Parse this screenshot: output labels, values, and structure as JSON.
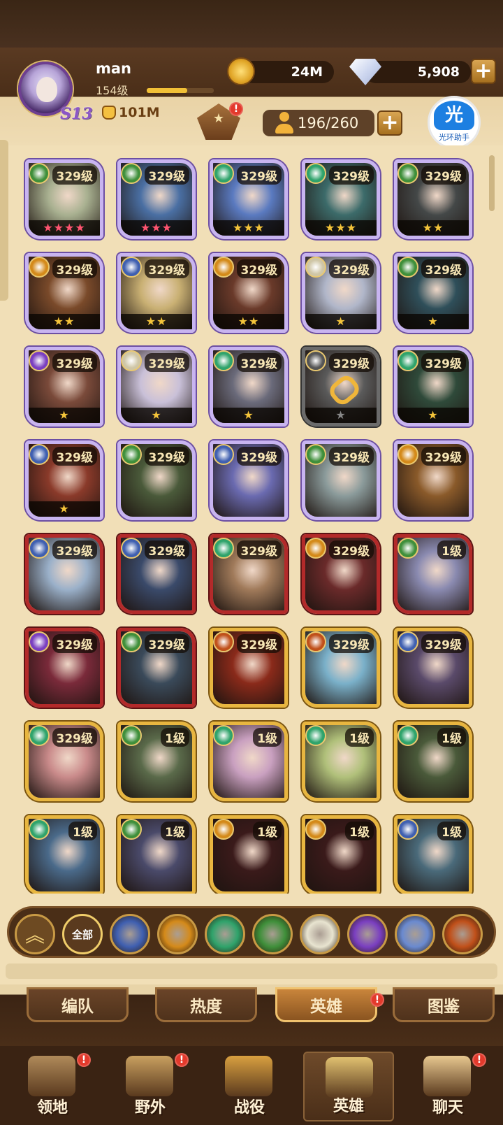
{
  "player": {
    "name": "man",
    "level": "154级",
    "season": "S13",
    "power": "101M",
    "xp_fraction": 0.6
  },
  "resources": {
    "gold": "24M",
    "diamonds": "5,908",
    "capacity": "196/260",
    "plus": "+"
  },
  "badges": {
    "alert": "!"
  },
  "helper": {
    "icon_text": "光",
    "label": "光环助手"
  },
  "heroes": [
    {
      "level": "329级",
      "frame": "purple",
      "stars": "★★★★",
      "star_color": "red",
      "faction": "#3f8f3a",
      "bg": "#a8b090"
    },
    {
      "level": "329级",
      "frame": "purple",
      "stars": "★★★",
      "star_color": "red",
      "faction": "#3f8f3a",
      "bg": "#4a6fa3"
    },
    {
      "level": "329级",
      "frame": "purple",
      "stars": "★★★",
      "star_color": "gold",
      "faction": "#2fa36b",
      "bg": "#5a7ac0"
    },
    {
      "level": "329级",
      "frame": "purple",
      "stars": "★★★",
      "star_color": "gold",
      "faction": "#2fa36b",
      "bg": "#3c6b6a"
    },
    {
      "level": "329级",
      "frame": "purple",
      "stars": "★★",
      "star_color": "gold",
      "faction": "#3f8f3a",
      "bg": "#444848"
    },
    {
      "level": "329级",
      "frame": "purple",
      "stars": "★★",
      "star_color": "gold",
      "faction": "#d48a1a",
      "bg": "#7a4a2a"
    },
    {
      "level": "329级",
      "frame": "purple",
      "stars": "★★",
      "star_color": "gold",
      "faction": "#3f5fb0",
      "bg": "#c9b073"
    },
    {
      "level": "329级",
      "frame": "purple",
      "stars": "★★",
      "star_color": "gold",
      "faction": "#d48a1a",
      "bg": "#6a3a2a"
    },
    {
      "level": "329级",
      "frame": "purple",
      "stars": "★",
      "star_color": "gold",
      "faction": "#cfc6a6",
      "bg": "#b0b6c9"
    },
    {
      "level": "329级",
      "frame": "purple",
      "stars": "★",
      "star_color": "gold",
      "faction": "#3f8f3a",
      "bg": "#2f4f5a"
    },
    {
      "level": "329级",
      "frame": "purple",
      "stars": "★",
      "star_color": "gold",
      "faction": "#7a3fc0",
      "bg": "#7a4a3a"
    },
    {
      "level": "329级",
      "frame": "purple",
      "stars": "★",
      "star_color": "gold",
      "faction": "#cfc6a6",
      "bg": "#c9c0d8"
    },
    {
      "level": "329级",
      "frame": "purple",
      "stars": "★",
      "star_color": "gold",
      "faction": "#2fa36b",
      "bg": "#6a6a7a"
    },
    {
      "level": "329级",
      "frame": "gray",
      "stars": "★",
      "star_color": "gray",
      "faction": "#555555",
      "bg": "#5a5a5a",
      "linked": true
    },
    {
      "level": "329级",
      "frame": "purple",
      "stars": "★",
      "star_color": "gold",
      "faction": "#2fa36b",
      "bg": "#2f4a3a"
    },
    {
      "level": "329级",
      "frame": "purple",
      "stars": "★",
      "star_color": "gold",
      "faction": "#3f5fb0",
      "bg": "#8a3a2a"
    },
    {
      "level": "329级",
      "frame": "purple",
      "stars": "",
      "star_color": "gold",
      "faction": "#3f8f3a",
      "bg": "#4a5a3a"
    },
    {
      "level": "329级",
      "frame": "purple",
      "stars": "",
      "star_color": "gold",
      "faction": "#3f5fb0",
      "bg": "#6a6ab0"
    },
    {
      "level": "329级",
      "frame": "purple",
      "stars": "",
      "star_color": "gold",
      "faction": "#3f8f3a",
      "bg": "#8a9a9a"
    },
    {
      "level": "329级",
      "frame": "purple",
      "stars": "",
      "star_color": "gold",
      "faction": "#d48a1a",
      "bg": "#8a5a2a"
    },
    {
      "level": "329级",
      "frame": "red",
      "stars": "",
      "star_color": "gold",
      "faction": "#3f5fb0",
      "bg": "#9ab0c9"
    },
    {
      "level": "329级",
      "frame": "red",
      "stars": "",
      "star_color": "gold",
      "faction": "#3f5fb0",
      "bg": "#3a4a6a"
    },
    {
      "level": "329级",
      "frame": "red",
      "stars": "",
      "star_color": "gold",
      "faction": "#2fa36b",
      "bg": "#a07a5a"
    },
    {
      "level": "329级",
      "frame": "red",
      "stars": "",
      "star_color": "gold",
      "faction": "#d48a1a",
      "bg": "#6a2a2a"
    },
    {
      "level": "1级",
      "frame": "red",
      "stars": "",
      "star_color": "gold",
      "faction": "#3f8f3a",
      "bg": "#8a8ab0"
    },
    {
      "level": "329级",
      "frame": "red",
      "stars": "",
      "star_color": "gold",
      "faction": "#7a3fc0",
      "bg": "#7a2a3a"
    },
    {
      "level": "329级",
      "frame": "red",
      "stars": "",
      "star_color": "gold",
      "faction": "#3f8f3a",
      "bg": "#3a4a5a"
    },
    {
      "level": "329级",
      "frame": "gold",
      "stars": "",
      "star_color": "gold",
      "faction": "#c0501a",
      "bg": "#8a2a1a"
    },
    {
      "level": "329级",
      "frame": "gold",
      "stars": "",
      "star_color": "gold",
      "faction": "#c0501a",
      "bg": "#7ab0c9"
    },
    {
      "level": "329级",
      "frame": "gold",
      "stars": "",
      "star_color": "gold",
      "faction": "#3f5fb0",
      "bg": "#5a4a6a"
    },
    {
      "level": "329级",
      "frame": "gold",
      "stars": "",
      "star_color": "gold",
      "faction": "#2fa36b",
      "bg": "#c98a8a"
    },
    {
      "level": "1级",
      "frame": "gold",
      "stars": "",
      "star_color": "gold",
      "faction": "#3f8f3a",
      "bg": "#5a6a4a"
    },
    {
      "level": "1级",
      "frame": "gold",
      "stars": "",
      "star_color": "gold",
      "faction": "#2fa36b",
      "bg": "#c9a0c0"
    },
    {
      "level": "1级",
      "frame": "gold",
      "stars": "",
      "star_color": "gold",
      "faction": "#2fa36b",
      "bg": "#b0c07a"
    },
    {
      "level": "1级",
      "frame": "gold",
      "stars": "",
      "star_color": "gold",
      "faction": "#2fa36b",
      "bg": "#4a5a3a"
    },
    {
      "level": "1级",
      "frame": "gold",
      "stars": "",
      "star_color": "gold",
      "faction": "#2fa36b",
      "bg": "#4a6a8a"
    },
    {
      "level": "1级",
      "frame": "gold",
      "stars": "",
      "star_color": "gold",
      "faction": "#3f8f3a",
      "bg": "#4a4a6a"
    },
    {
      "level": "1级",
      "frame": "gold",
      "stars": "",
      "star_color": "gold",
      "faction": "#d48a1a",
      "bg": "#3a1a1a"
    },
    {
      "level": "1级",
      "frame": "gold",
      "stars": "",
      "star_color": "gold",
      "faction": "#d48a1a",
      "bg": "#3a1a1a"
    },
    {
      "level": "1级",
      "frame": "gold",
      "stars": "",
      "star_color": "gold",
      "faction": "#3f5fb0",
      "bg": "#4a6a7a"
    }
  ],
  "filters": {
    "all_label": "全部",
    "factions": [
      {
        "name": "lightbearer-icon",
        "color": "#3f5fb0"
      },
      {
        "name": "mauler-icon",
        "color": "#d48a1a"
      },
      {
        "name": "wilder-icon",
        "color": "#2fa36b"
      },
      {
        "name": "graveborn-icon",
        "color": "#3f8f3a"
      },
      {
        "name": "celestial-icon",
        "color": "#e8e4d0"
      },
      {
        "name": "hypogean-icon",
        "color": "#7a3fc0"
      },
      {
        "name": "dimensional-icon",
        "color": "#6a8ad0"
      },
      {
        "name": "draconis-icon",
        "color": "#c0501a"
      }
    ]
  },
  "subtabs": [
    {
      "label": "编队",
      "active": false,
      "alert": false
    },
    {
      "label": "热度",
      "active": false,
      "alert": false
    },
    {
      "label": "英雄",
      "active": true,
      "alert": true
    },
    {
      "label": "图鉴",
      "active": false,
      "alert": false
    }
  ],
  "nav": [
    {
      "label": "领地",
      "icon": "castle-icon",
      "alert": true,
      "active": false,
      "color": "#b08a5a"
    },
    {
      "label": "野外",
      "icon": "map-scroll-icon",
      "alert": true,
      "active": false,
      "color": "#c9a060"
    },
    {
      "label": "战役",
      "icon": "sword-icon",
      "alert": false,
      "active": false,
      "color": "#d9a040"
    },
    {
      "label": "英雄",
      "icon": "helmet-icon",
      "alert": false,
      "active": true,
      "color": "#e0c070"
    },
    {
      "label": "聊天",
      "icon": "chat-bubble-icon",
      "alert": true,
      "active": false,
      "color": "#e8c890"
    }
  ]
}
